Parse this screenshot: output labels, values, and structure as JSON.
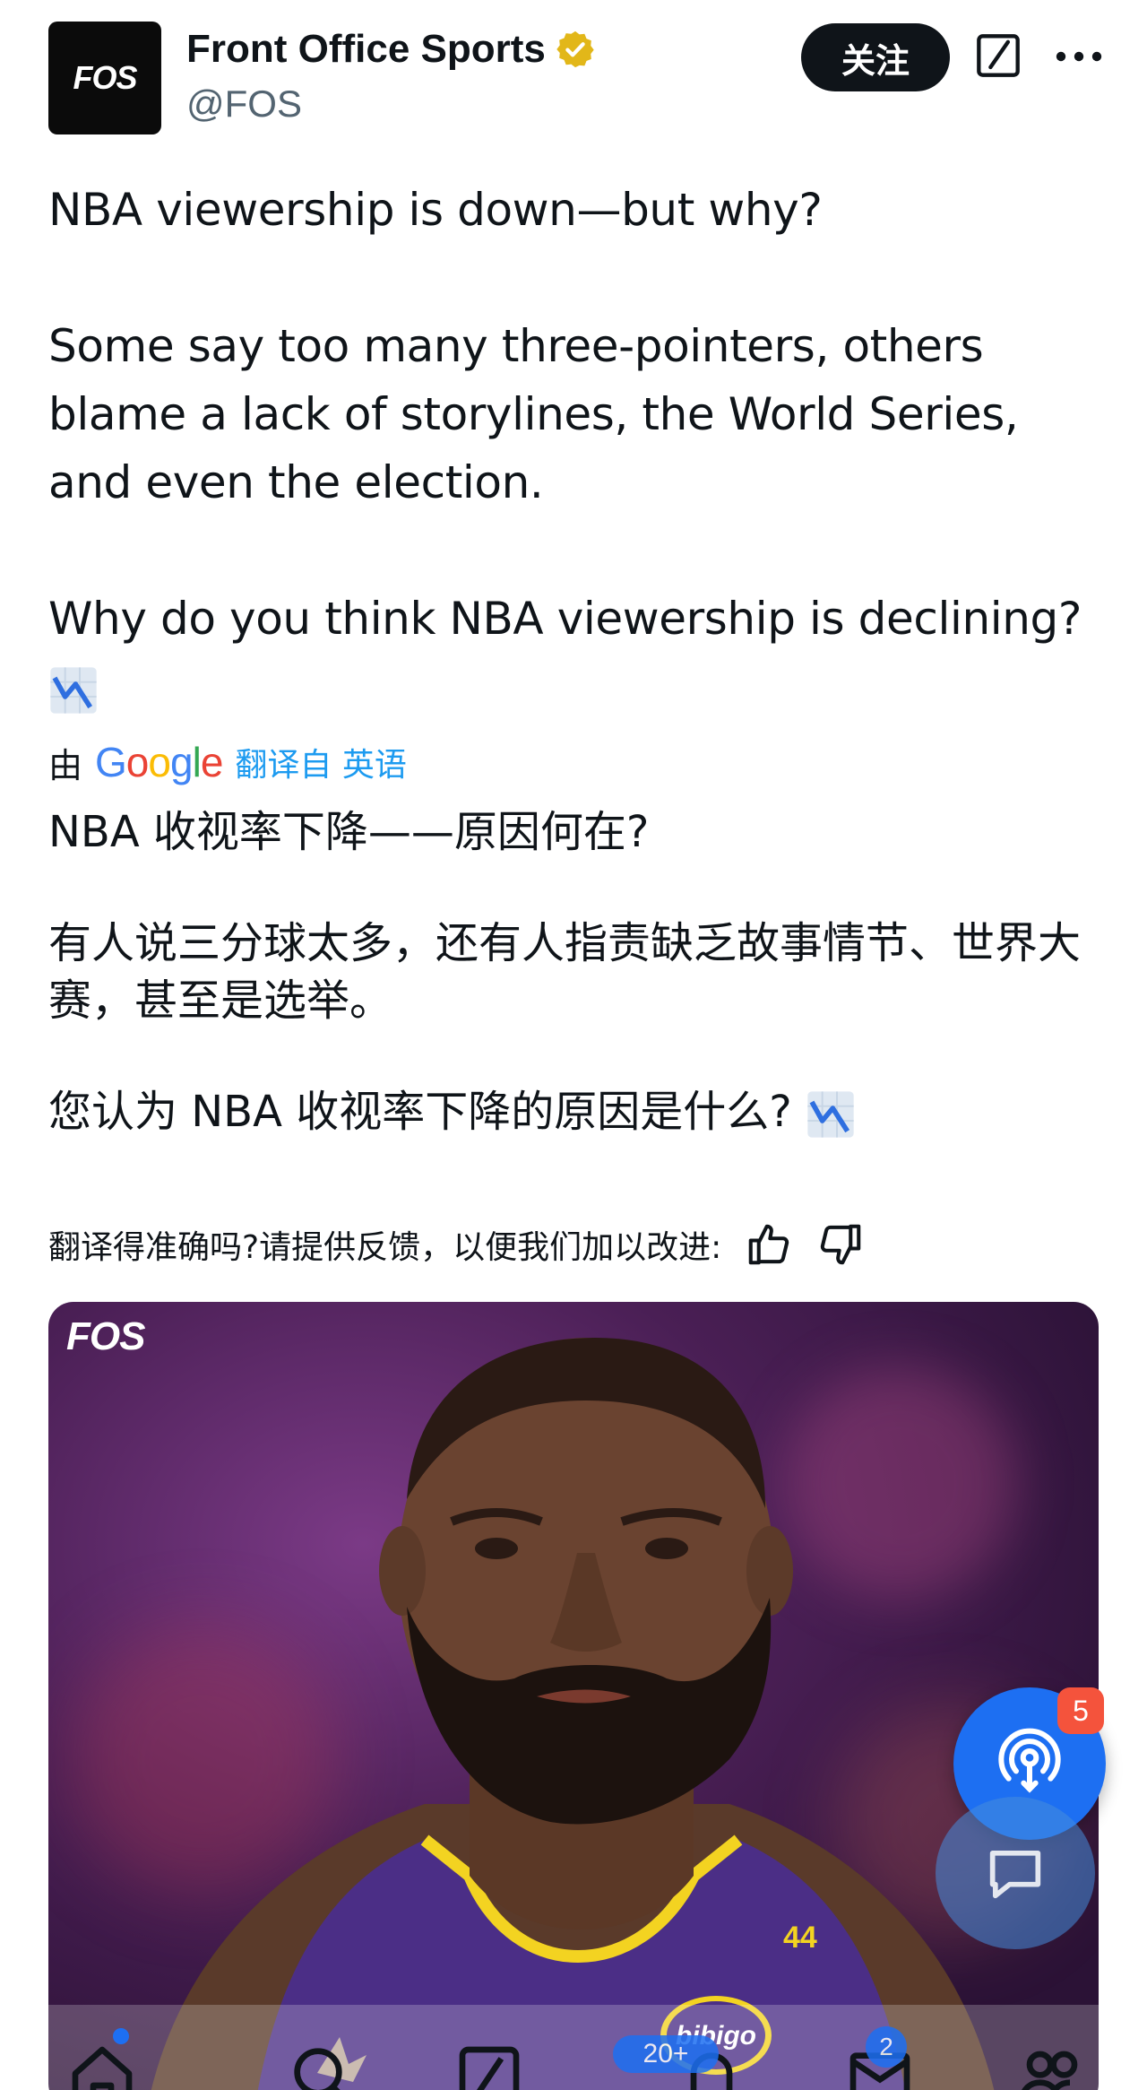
{
  "account": {
    "avatar_text": "FOS",
    "display_name": "Front Office Sports",
    "handle": "@FOS",
    "verified_color": "#e2b719"
  },
  "header": {
    "follow_label": "关注"
  },
  "post": {
    "lines": [
      "NBA viewership is down—but why?",
      "Some say too many three-pointers, others blame a lack of storylines, the World Series, and even the election.",
      "Why do you think NBA viewership is declining?"
    ],
    "emoji": "chart-decreasing"
  },
  "translation": {
    "by_label": "由",
    "provider": "Google",
    "link_text": "翻译自 英语",
    "lines": [
      "NBA 收视率下降——原因何在?",
      "有人说三分球太多，还有人指责缺乏故事情节、世界大赛，甚至是选举。",
      "您认为 NBA 收视率下降的原因是什么?"
    ],
    "feedback_text": "翻译得准确吗?请提供反馈，以便我们加以改进:"
  },
  "media": {
    "watermark": "FOS",
    "jersey_number": "44",
    "patch_text": "bibigo"
  },
  "floating": {
    "spaces_badge": "5"
  },
  "bottom_nav": {
    "notifications_badge": "20+",
    "messages_badge": "2"
  },
  "colors": {
    "accent": "#1d9bf0",
    "fab_blue": "#1d6ff2",
    "badge_red": "#f4533c"
  }
}
